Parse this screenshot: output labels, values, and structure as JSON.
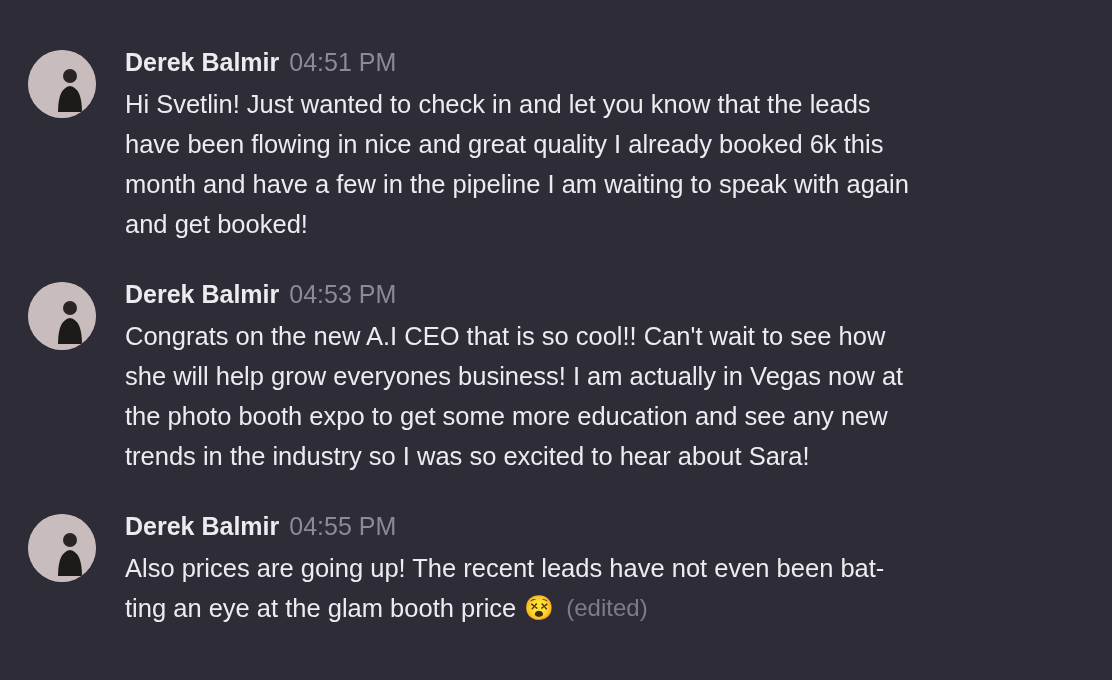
{
  "messages": [
    {
      "author": "Derek Balmir",
      "time": "04:51 PM",
      "lines": [
        "Hi Svetlin! Just wanted to check in and let you know that the leads",
        "have been flowing in nice and great quality I already booked 6k this",
        "month and have a few in the pipeline I am waiting to speak with again",
        "and get booked!"
      ]
    },
    {
      "author": "Derek Balmir",
      "time": "04:53 PM",
      "lines": [
        "Congrats on the new A.I CEO that is so cool!! Can't wait to see how",
        "she will help grow everyones business! I am actually in Vegas now at",
        "the photo booth expo to get some more education and see any new",
        "trends in the industry so I was so excited to hear about Sara!"
      ]
    },
    {
      "author": "Derek Balmir",
      "time": "04:55 PM",
      "lines": [
        "Also prices are going up! The recent leads have not even been bat-",
        "ting an eye at the glam booth price"
      ],
      "emoji": "😵",
      "edited": "(edited)"
    }
  ]
}
